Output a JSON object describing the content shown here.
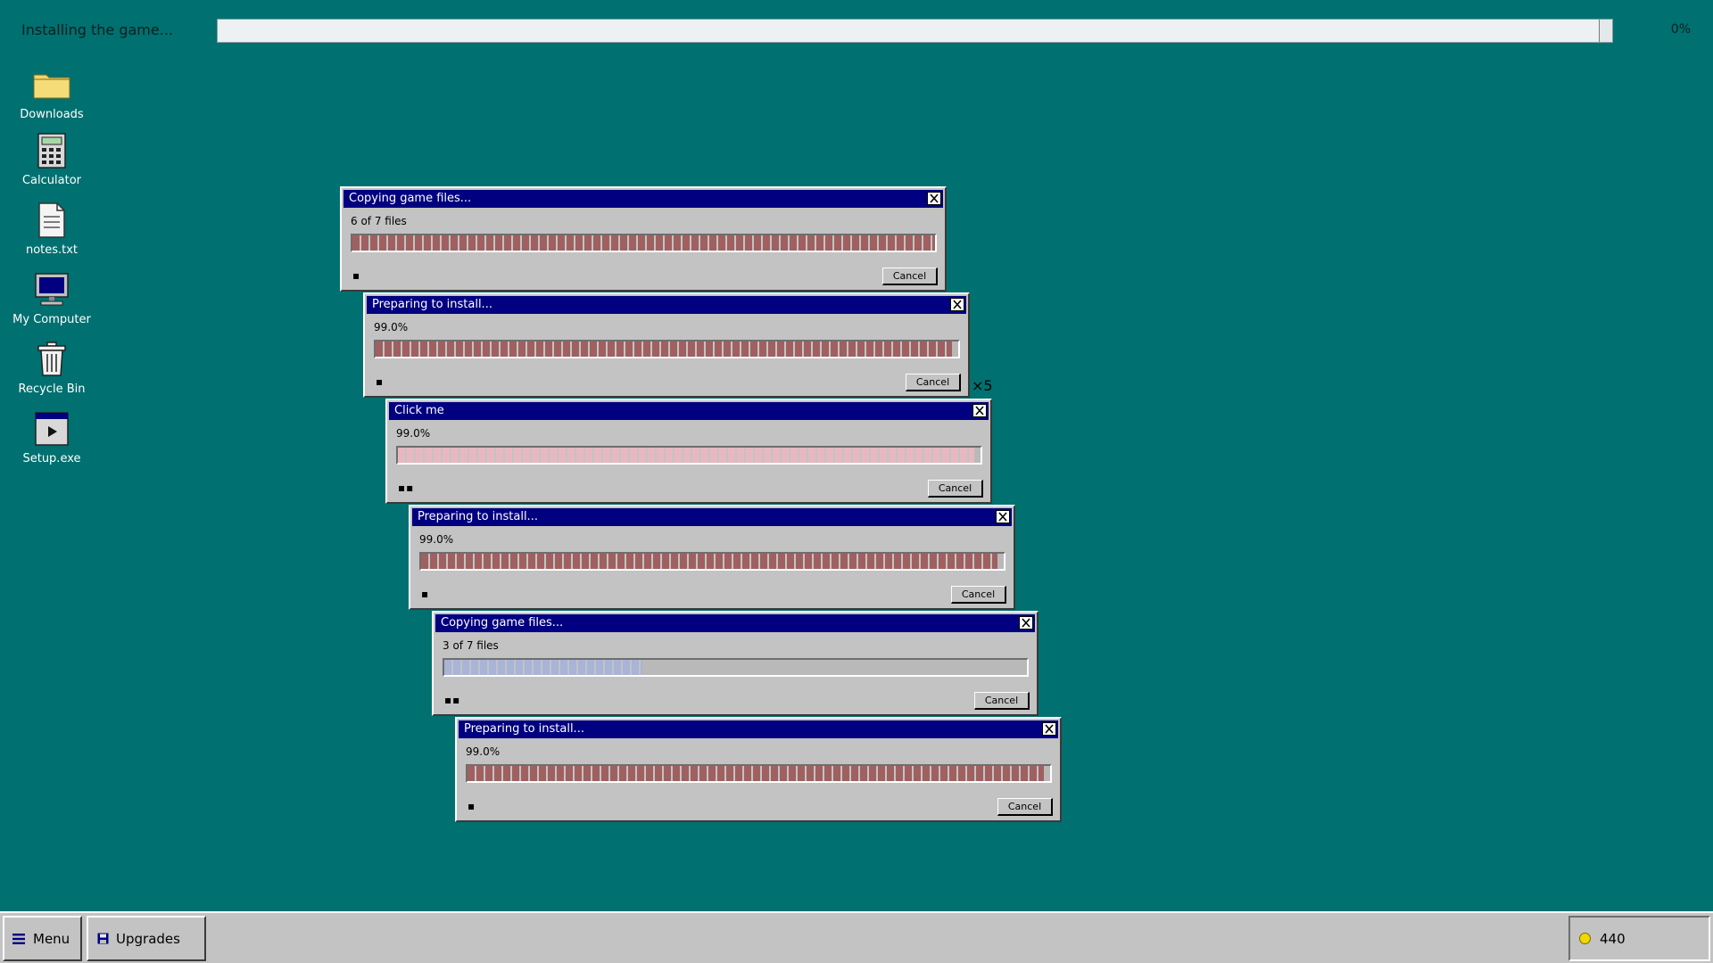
{
  "top": {
    "title": "Installing the game...",
    "percent_label": "0%",
    "progress": 0
  },
  "desktop_icons": [
    {
      "label": "Downloads",
      "icon": "folder-icon"
    },
    {
      "label": "Calculator",
      "icon": "calculator-icon"
    },
    {
      "label": "notes.txt",
      "icon": "text-file-icon"
    },
    {
      "label": "My Computer",
      "icon": "computer-icon"
    },
    {
      "label": "Recycle Bin",
      "icon": "recycle-bin-icon"
    },
    {
      "label": "Setup.exe",
      "icon": "setup-exe-icon"
    }
  ],
  "dialogs": [
    {
      "title": "Copying game files...",
      "status": "6 of 7 files",
      "progress": 1.0,
      "fill": "red-segmented",
      "dots": "▪",
      "cancel": "Cancel"
    },
    {
      "title": "Preparing to install...",
      "status": "99.0%",
      "progress": 0.99,
      "fill": "red-segmented",
      "dots": "▪",
      "cancel": "Cancel"
    },
    {
      "title": "Click me",
      "status": "99.0%",
      "progress": 0.99,
      "fill": "pink-segmented",
      "dots": "▪▪",
      "cancel": "Cancel"
    },
    {
      "title": "Preparing to install...",
      "status": "99.0%",
      "progress": 0.99,
      "fill": "red-segmented",
      "dots": "▪",
      "cancel": "Cancel"
    },
    {
      "title": "Copying game files...",
      "status": "3 of 7 files",
      "progress": 0.34,
      "fill": "blue-segmented",
      "dots": "▪▪",
      "cancel": "Cancel"
    },
    {
      "title": "Preparing to install...",
      "status": "99.0%",
      "progress": 0.99,
      "fill": "red-segmented",
      "dots": "▪",
      "cancel": "Cancel"
    }
  ],
  "multiplier": "×5",
  "taskbar": {
    "menu_label": "Menu",
    "upgrades_label": "Upgrades",
    "coins": "440"
  },
  "colors": {
    "desktop": "#007070",
    "title_bar": "#000080",
    "window_face": "#c3c3c3",
    "red_fill": "#a06060",
    "pink_fill": "#e8b8c0",
    "blue_fill": "#a8b4d8",
    "coin": "#f0d800"
  }
}
